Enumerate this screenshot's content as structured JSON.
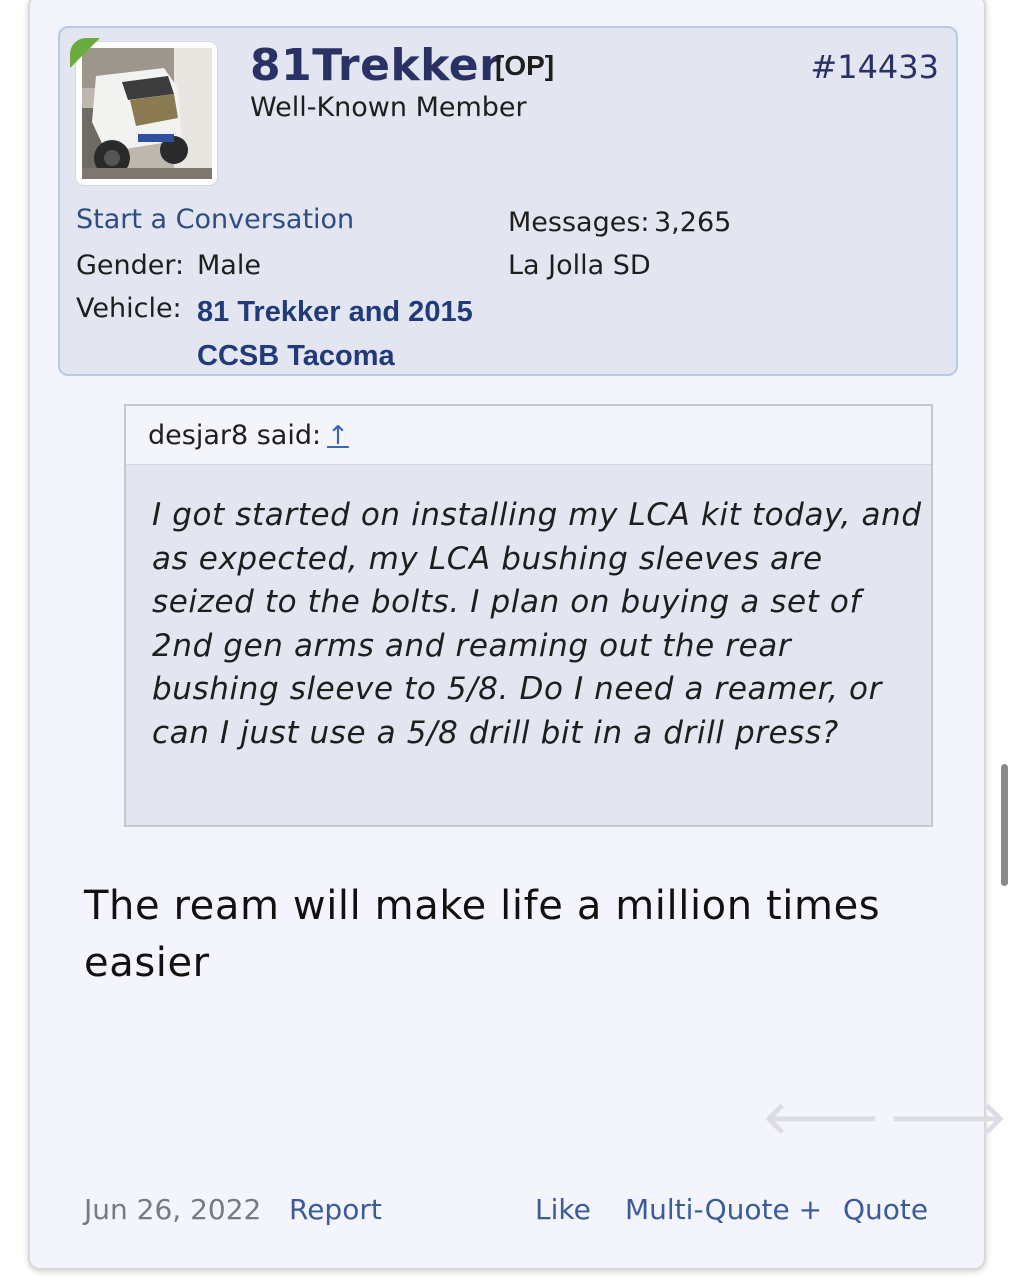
{
  "author": {
    "username": "81Trekker",
    "op_tag": "[OP]",
    "title": "Well-Known Member",
    "start_conversation": "Start a Conversation",
    "gender_label": "Gender:",
    "gender": "Male",
    "vehicle_label": "Vehicle:",
    "vehicle_line1": "81 Trekker and 2015",
    "vehicle_line2": "CCSB Tacoma",
    "messages_label": "Messages:",
    "messages": "3,265",
    "location": "La Jolla SD",
    "avatar_alt": "white Toyota truck in garage"
  },
  "post": {
    "number": "#14433",
    "quote_author": "desjar8 said:",
    "quote_arrow": "↑",
    "quote_text": "I got started on installing my LCA kit today, and as expected, my LCA bushing sleeves are seized to the bolts. I plan on buying a set of 2nd gen arms and reaming out the rear bushing sleeve to 5/8. Do I need a reamer, or can I just use a 5/8 drill bit in a drill press?",
    "message_text": "The ream will make life a million times easier",
    "date": "Jun 26, 2022"
  },
  "footer": {
    "report": "Report",
    "like": "Like",
    "multi_quote": "Multi-Quote +",
    "quote": "Quote"
  },
  "colors": {
    "username": "#2a3164",
    "link": "#3b5b9a",
    "userbox_bg": "#e3e5f1",
    "online": "#6aab3f"
  },
  "icons": {
    "prev": "arrow-left-icon",
    "next": "arrow-right-icon"
  }
}
